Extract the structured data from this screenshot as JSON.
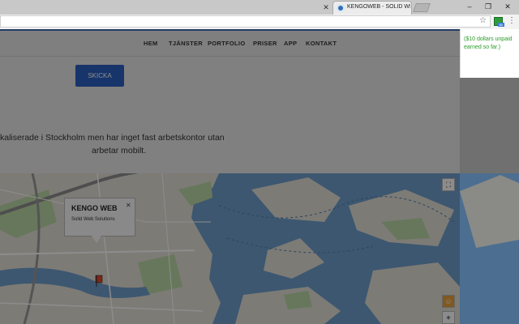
{
  "browser": {
    "tab_title": "KENGOWEB - SOLID WE",
    "prev_tab_close": "✕",
    "minimize": "–",
    "restore": "❐",
    "close": "✕",
    "star_glyph": "☆",
    "menu_glyph": "⋮",
    "ext_badge": "$0"
  },
  "extension_popup": {
    "line1": "($10 dollars unpaid",
    "line2": "earned so far.)"
  },
  "nav": {
    "items": [
      "HEM",
      "TJÄNSTER",
      "PORTFOLIO",
      "PRISER",
      "APP",
      "KONTAKT"
    ]
  },
  "content": {
    "send_label": "SKICKA",
    "info_line1": "kaliserade i Stockholm men har inget fast arbetskontor utan",
    "info_line2": "arbetar mobilt."
  },
  "map": {
    "popup_title": "KENGO WEB",
    "popup_subtitle": "Solid Web Solutions",
    "popup_close": "✕",
    "zoom_in": "+",
    "fullscreen": "⛶",
    "pegman": "☺"
  },
  "colors": {
    "accent": "#2b62c4",
    "extension_text": "#2a9b2a",
    "water": "#6f9fcc"
  }
}
